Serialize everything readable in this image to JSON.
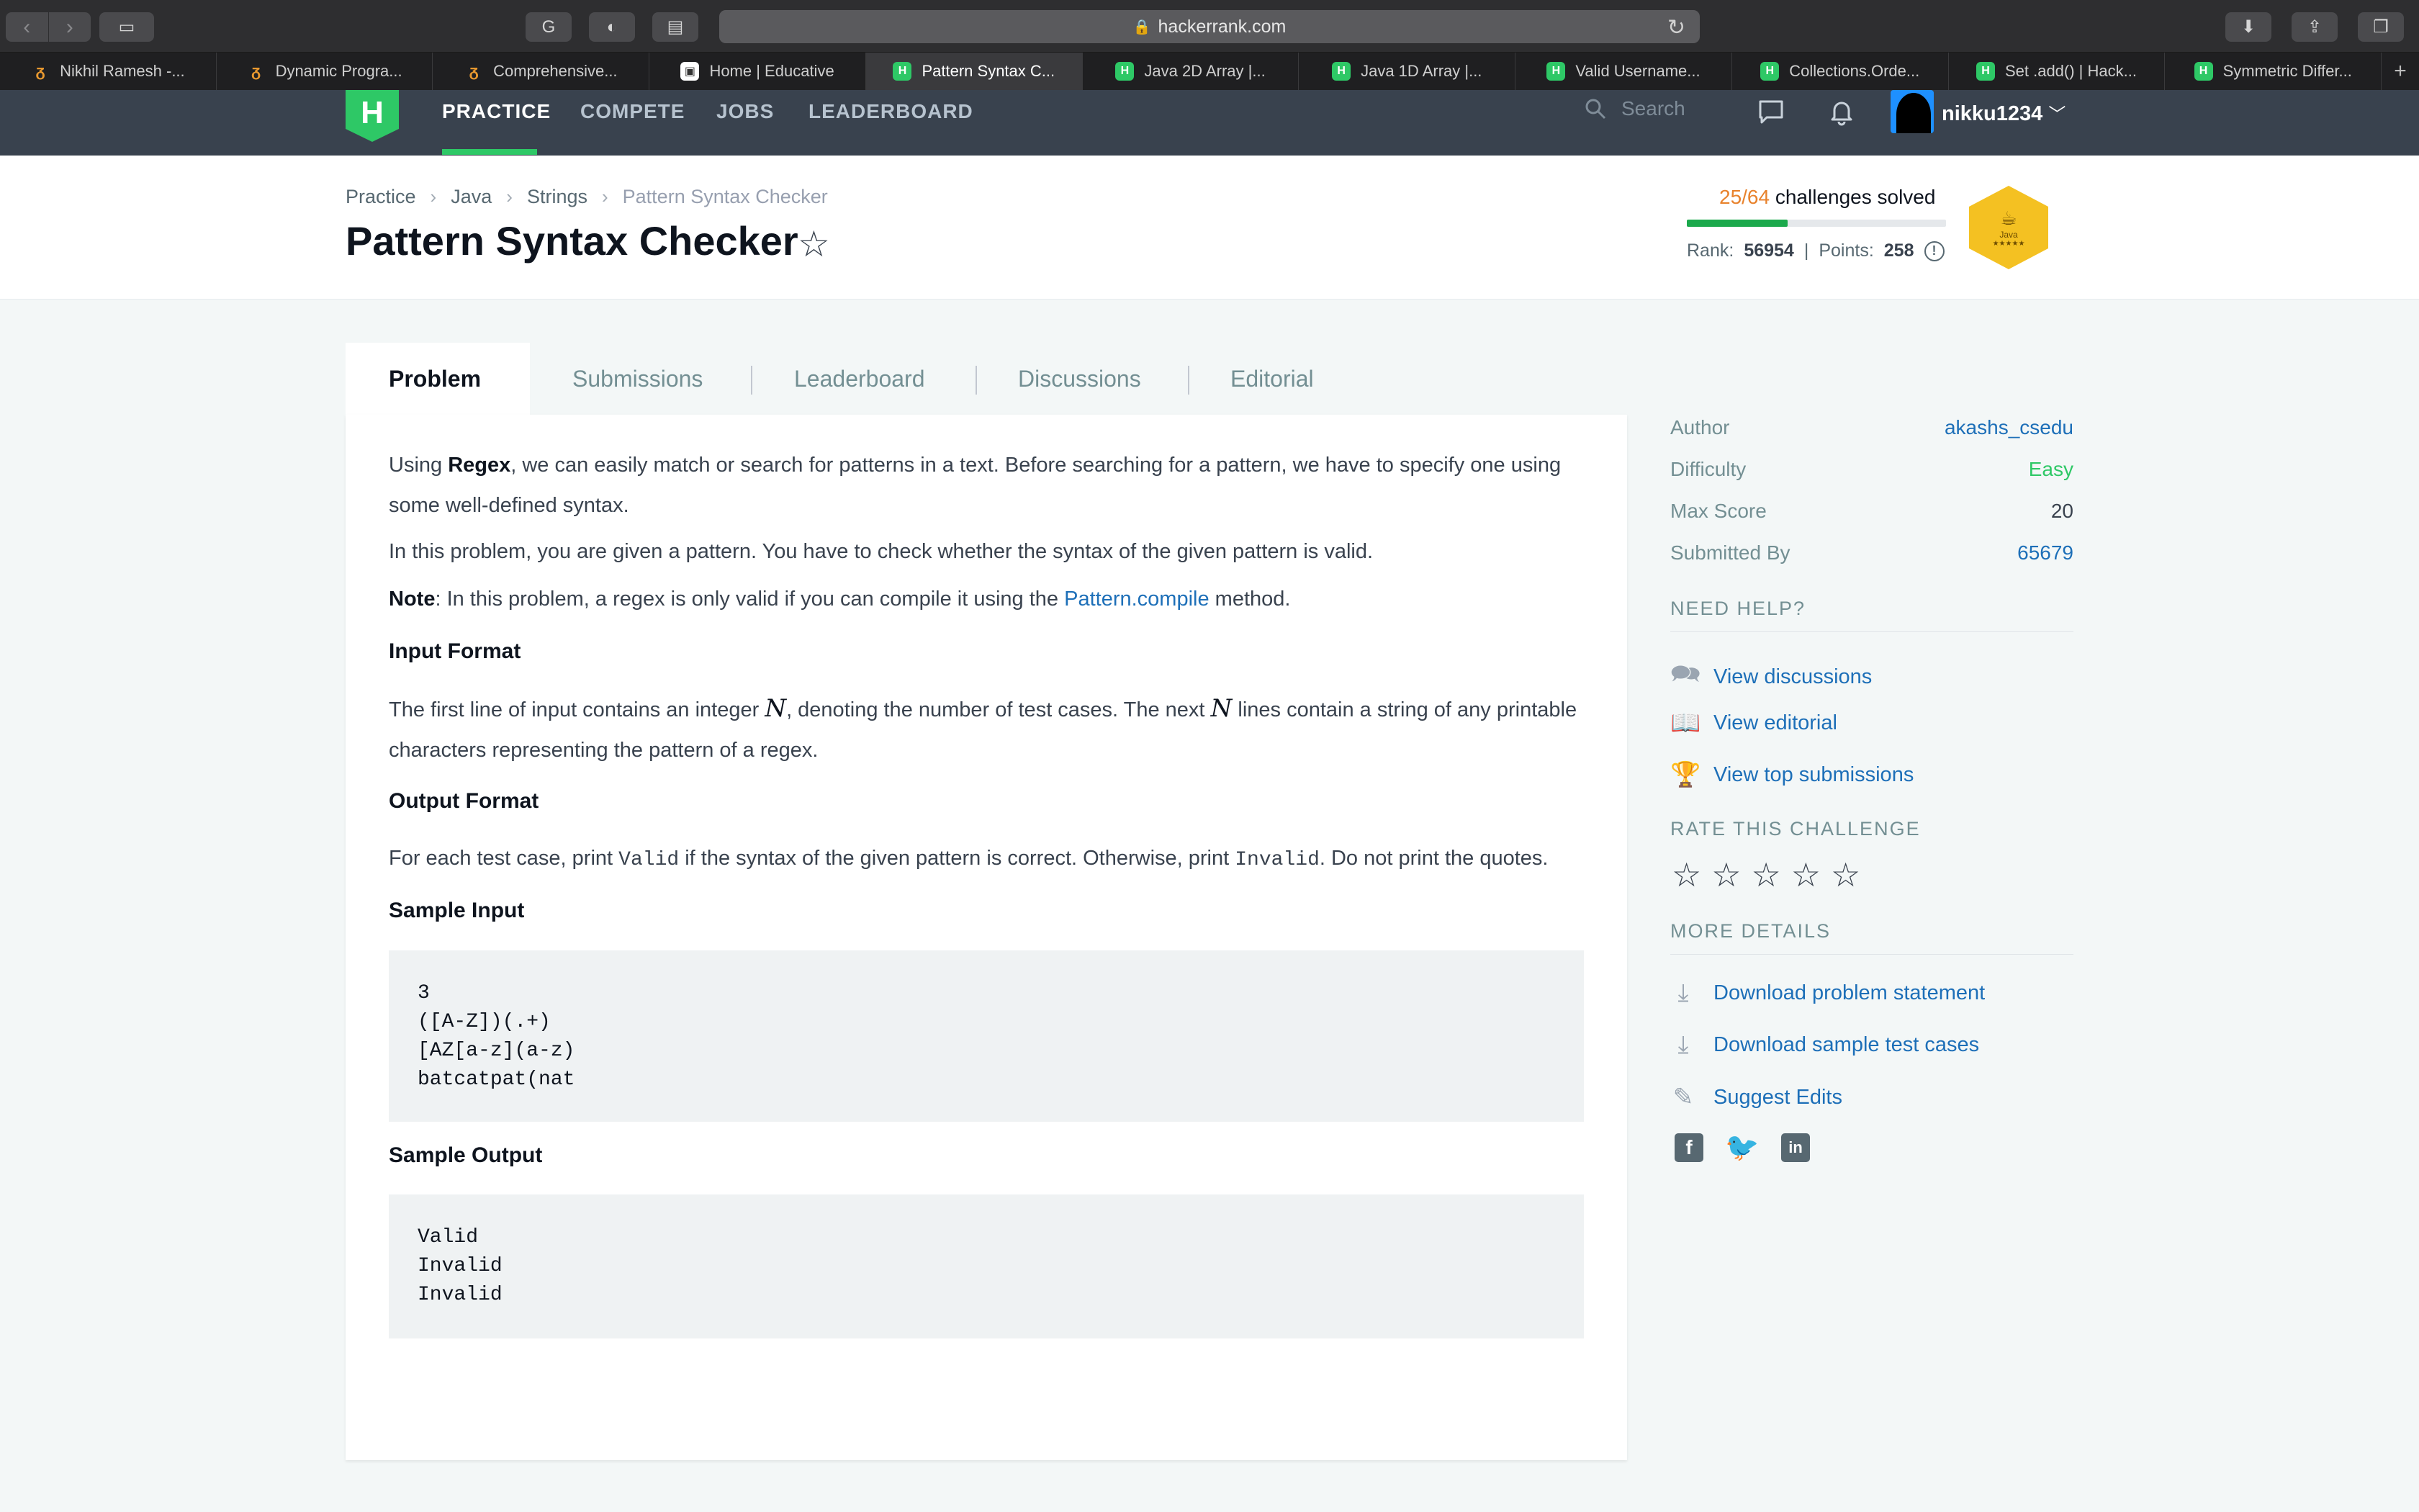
{
  "browser": {
    "url": "hackerrank.com",
    "tabs": [
      {
        "label": "Nikhil Ramesh -...",
        "icon": "coding-site-icon",
        "active": false
      },
      {
        "label": "Dynamic Progra...",
        "icon": "coding-site-icon",
        "active": false
      },
      {
        "label": "Comprehensive...",
        "icon": "coding-site-icon",
        "active": false
      },
      {
        "label": "Home | Educative",
        "icon": "educative-icon",
        "active": false
      },
      {
        "label": "Pattern Syntax C...",
        "icon": "hackerrank-icon",
        "active": true
      },
      {
        "label": "Java 2D Array |...",
        "icon": "hackerrank-icon",
        "active": false
      },
      {
        "label": "Java 1D Array |...",
        "icon": "hackerrank-icon",
        "active": false
      },
      {
        "label": "Valid Username...",
        "icon": "hackerrank-icon",
        "active": false
      },
      {
        "label": "Collections.Orde...",
        "icon": "hackerrank-icon",
        "active": false
      },
      {
        "label": "Set .add() | Hack...",
        "icon": "hackerrank-icon",
        "active": false
      },
      {
        "label": "Symmetric Differ...",
        "icon": "hackerrank-icon",
        "active": false
      }
    ]
  },
  "nav": {
    "logo": "H",
    "links": [
      "PRACTICE",
      "COMPETE",
      "JOBS",
      "LEADERBOARD"
    ],
    "search_placeholder": "Search",
    "username": "nikku1234"
  },
  "breadcrumb": [
    "Practice",
    "Java",
    "Strings",
    "Pattern Syntax Checker"
  ],
  "title": "Pattern Syntax Checker",
  "progress": {
    "solved": "25/64",
    "suffix": "challenges solved",
    "fraction": 0.39,
    "rank_label": "Rank:",
    "rank": "56954",
    "points_label": "Points:",
    "points": "258"
  },
  "badge": {
    "label": "Java",
    "stars": "★★★★★"
  },
  "tabs": [
    "Problem",
    "Submissions",
    "Leaderboard",
    "Discussions",
    "Editorial"
  ],
  "problem": {
    "p1_pre": "Using ",
    "p1_bold": "Regex",
    "p1_post": ", we can easily match or search for patterns in a text. Before searching for a pattern, we have to specify one using some well-defined syntax.",
    "p2": "In this problem, you are given a pattern. You have to check whether the syntax of the given pattern is valid.",
    "note_bold": "Note",
    "note_pre": ": In this problem, a regex is only valid if you can compile it using the ",
    "note_link": "Pattern.compile",
    "note_post": " method.",
    "input_heading": "Input Format",
    "input_a": "The first line of input contains an integer ",
    "input_var": "N",
    "input_b": ", denoting the number of test cases. The next ",
    "input_c": " lines contain a string of any printable characters representing the pattern of a regex.",
    "output_heading": "Output Format",
    "output_a": "For each test case, print ",
    "output_valid": "Valid",
    "output_b": " if the syntax of the given pattern is correct. Otherwise, print ",
    "output_invalid": "Invalid",
    "output_c": ". Do not print the quotes.",
    "sample_input_heading": "Sample Input",
    "sample_input": "3\n([A-Z])(.+)\n[AZ[a-z](a-z)\nbatcatpat(nat",
    "sample_output_heading": "Sample Output",
    "sample_output": "Valid\nInvalid\nInvalid"
  },
  "sidebar": {
    "author_label": "Author",
    "author": "akashs_csedu",
    "difficulty_label": "Difficulty",
    "difficulty": "Easy",
    "max_score_label": "Max Score",
    "max_score": "20",
    "submitted_label": "Submitted By",
    "submitted": "65679",
    "need_help": "NEED HELP?",
    "help_links": [
      "View discussions",
      "View editorial",
      "View top submissions"
    ],
    "rate": "RATE THIS CHALLENGE",
    "rating": 0,
    "more_details": "MORE DETAILS",
    "detail_links": [
      "Download problem statement",
      "Download sample test cases",
      "Suggest Edits"
    ],
    "socials": [
      "facebook-icon",
      "twitter-icon",
      "linkedin-icon"
    ]
  },
  "colors": {
    "brand_green": "#2ec866",
    "nav_bg": "#39424e",
    "link_blue": "#1d6fb8",
    "progress_orange": "#e8822c"
  }
}
